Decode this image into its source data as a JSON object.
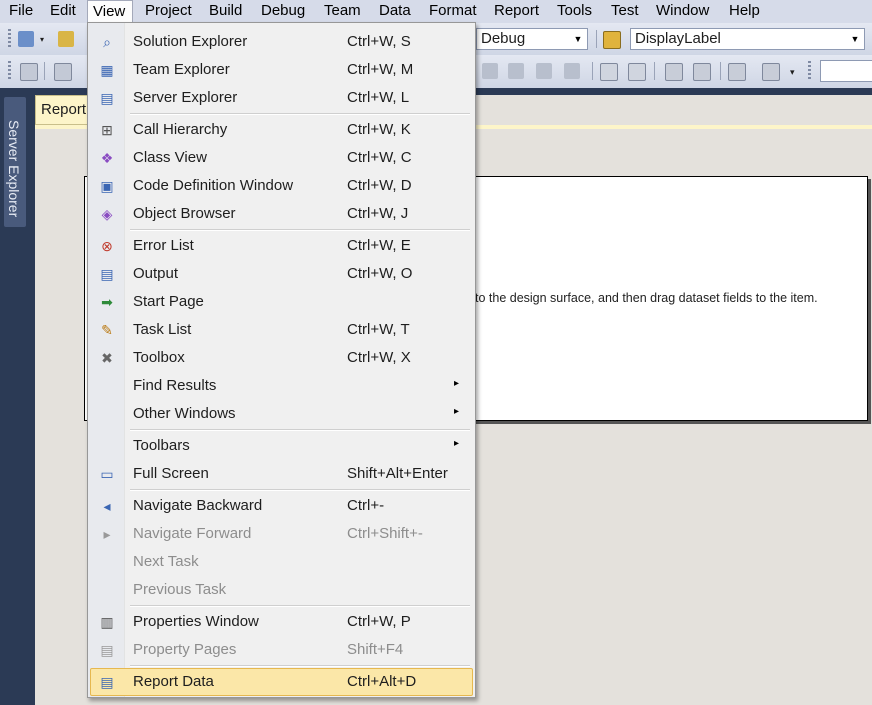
{
  "menubar": {
    "items": [
      "File",
      "Edit",
      "View",
      "Project",
      "Build",
      "Debug",
      "Team",
      "Data",
      "Format",
      "Report",
      "Tools",
      "Test",
      "Window",
      "Help"
    ],
    "open": "View"
  },
  "toolbar": {
    "config_combo": "Debug",
    "label_combo": "DisplayLabel"
  },
  "left_panel": {
    "server_explorer_tab": "Server Explorer"
  },
  "document": {
    "tab_label": "Report",
    "hint_text": "to the design surface, and then drag dataset fields to the item."
  },
  "view_menu": {
    "items": [
      {
        "label": "Solution Explorer",
        "shortcut": "Ctrl+W, S",
        "icon": "solution-explorer-icon"
      },
      {
        "label": "Team Explorer",
        "shortcut": "Ctrl+W, M",
        "icon": "team-explorer-icon"
      },
      {
        "label": "Server Explorer",
        "shortcut": "Ctrl+W, L",
        "icon": "server-explorer-icon"
      },
      {
        "label": "Call Hierarchy",
        "shortcut": "Ctrl+W, K",
        "icon": "call-hierarchy-icon"
      },
      {
        "label": "Class View",
        "shortcut": "Ctrl+W, C",
        "icon": "class-view-icon"
      },
      {
        "label": "Code Definition Window",
        "shortcut": "Ctrl+W, D",
        "icon": "code-definition-icon"
      },
      {
        "label": "Object Browser",
        "shortcut": "Ctrl+W, J",
        "icon": "object-browser-icon"
      },
      {
        "label": "Error List",
        "shortcut": "Ctrl+W, E",
        "icon": "error-list-icon"
      },
      {
        "label": "Output",
        "shortcut": "Ctrl+W, O",
        "icon": "output-icon"
      },
      {
        "label": "Start Page",
        "shortcut": "",
        "icon": "start-page-icon"
      },
      {
        "label": "Task List",
        "shortcut": "Ctrl+W, T",
        "icon": "task-list-icon"
      },
      {
        "label": "Toolbox",
        "shortcut": "Ctrl+W, X",
        "icon": "toolbox-icon"
      },
      {
        "label": "Find Results",
        "shortcut": "",
        "icon": ""
      },
      {
        "label": "Other Windows",
        "shortcut": "",
        "icon": ""
      },
      {
        "label": "Toolbars",
        "shortcut": "",
        "icon": ""
      },
      {
        "label": "Full Screen",
        "shortcut": "Shift+Alt+Enter",
        "icon": "full-screen-icon"
      },
      {
        "label": "Navigate Backward",
        "shortcut": "Ctrl+-",
        "icon": "navigate-backward-icon"
      },
      {
        "label": "Navigate Forward",
        "shortcut": "Ctrl+Shift+-",
        "icon": "navigate-forward-icon"
      },
      {
        "label": "Next Task",
        "shortcut": "",
        "icon": ""
      },
      {
        "label": "Previous Task",
        "shortcut": "",
        "icon": ""
      },
      {
        "label": "Properties Window",
        "shortcut": "Ctrl+W, P",
        "icon": "properties-window-icon"
      },
      {
        "label": "Property Pages",
        "shortcut": "Shift+F4",
        "icon": "property-pages-icon"
      },
      {
        "label": "Report Data",
        "shortcut": "Ctrl+Alt+D",
        "icon": "report-data-icon"
      }
    ],
    "submenu_glyph": "▸"
  },
  "colors": {
    "menu_highlight": "#fbe7a8",
    "doc_tab": "#fdf5c9",
    "shell_background": "#2b3a55"
  }
}
